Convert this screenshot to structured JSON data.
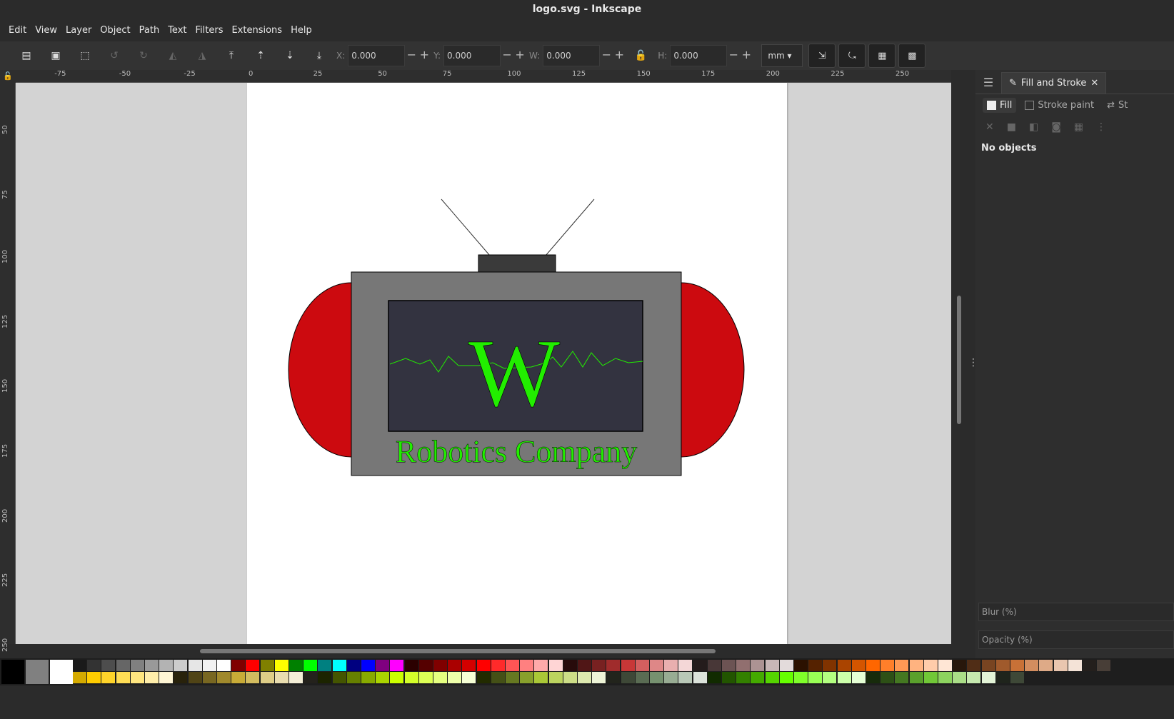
{
  "window": {
    "title": "logo.svg - Inkscape"
  },
  "menu": [
    "Edit",
    "View",
    "Layer",
    "Object",
    "Path",
    "Text",
    "Filters",
    "Extensions",
    "Help"
  ],
  "toolbar": {
    "x_label": "X:",
    "x_value": "0.000",
    "y_label": "Y:",
    "y_value": "0.000",
    "w_label": "W:",
    "w_value": "0.000",
    "h_label": "H:",
    "h_value": "0.000",
    "unit": "mm"
  },
  "rulers": {
    "h_ticks": [
      "-75",
      "-50",
      "-25",
      "0",
      "25",
      "50",
      "75",
      "100",
      "125",
      "150",
      "175",
      "200",
      "225",
      "250"
    ],
    "v_ticks": [
      "50",
      "75",
      "100",
      "125",
      "150",
      "175",
      "200",
      "225",
      "250"
    ]
  },
  "logo": {
    "letter": "W",
    "company": "Robotics Company",
    "colors": {
      "red": "#cc0a0f",
      "body": "#777777",
      "screen": "#333340",
      "green": "#22ee00",
      "antenna_box": "#3a3a3a"
    }
  },
  "dock": {
    "tab_label": "Fill and Stroke",
    "subtabs": [
      "Fill",
      "Stroke paint",
      "St"
    ],
    "status": "No objects",
    "blur_label": "Blur (%)",
    "opacity_label": "Opacity (%)"
  },
  "palette": {
    "big": [
      "#000000",
      "#808080",
      "#ffffff"
    ],
    "row1": [
      "#1a1a1a",
      "#333333",
      "#4d4d4d",
      "#666666",
      "#808080",
      "#999999",
      "#b3b3b3",
      "#cccccc",
      "#e6e6e6",
      "#f2f2f2",
      "#ffffff",
      "#800000",
      "#ff0000",
      "#808000",
      "#ffff00",
      "#008000",
      "#00ff00",
      "#008080",
      "#00ffff",
      "#000080",
      "#0000ff",
      "#800080",
      "#ff00ff",
      "#2b0000",
      "#550000",
      "#800000",
      "#aa0000",
      "#d40000",
      "#ff0000",
      "#ff2a2a",
      "#ff5555",
      "#ff8080",
      "#ffaaaa",
      "#ffd5d5",
      "#280b0b",
      "#501616",
      "#782121",
      "#a02c2c",
      "#c83737",
      "#d35f5f",
      "#de8787",
      "#e9afaf",
      "#f4d7d7",
      "#241c1c",
      "#483737",
      "#6c5353",
      "#916f6f",
      "#ac9393",
      "#c8b7b7",
      "#e3dbdb",
      "#2b1100",
      "#552200",
      "#803300",
      "#aa4400",
      "#d45500",
      "#ff6600",
      "#ff7f2a",
      "#ff9955",
      "#ffb380",
      "#ffccaa",
      "#ffe6d5",
      "#28170b",
      "#502d16",
      "#784421",
      "#a05a2c",
      "#c87137",
      "#d38d5f",
      "#deaa87",
      "#e9c6af",
      "#f4e3d7",
      "#241f1c",
      "#483e37"
    ],
    "row2": [
      "#d4aa00",
      "#ffcc00",
      "#ffd42a",
      "#ffdd55",
      "#ffe680",
      "#ffeeaa",
      "#fff6d5",
      "#28220b",
      "#504416",
      "#786721",
      "#a0892c",
      "#c8ab37",
      "#d3bc5f",
      "#decd87",
      "#e9ddaf",
      "#f4eed7",
      "#24221c",
      "#1c2400",
      "#445500",
      "#668000",
      "#88aa00",
      "#aad400",
      "#ccff00",
      "#d4ff2a",
      "#ddff55",
      "#e5ff80",
      "#eeffaa",
      "#f6ffd5",
      "#222b00",
      "#445016",
      "#667821",
      "#88a02c",
      "#aac837",
      "#bcd35f",
      "#cdde87",
      "#dde9af",
      "#eef4d7",
      "#22241c",
      "#3e4837",
      "#5a6c53",
      "#76916f",
      "#98ac93",
      "#b9c8b7",
      "#dce3db",
      "#112b00",
      "#225500",
      "#338000",
      "#44aa00",
      "#55d400",
      "#66ff00",
      "#7fff2a",
      "#99ff55",
      "#b3ff80",
      "#ccffaa",
      "#e5ffd5",
      "#172b0b",
      "#2d5016",
      "#447821",
      "#5aa02c",
      "#71c837",
      "#8dd35f",
      "#aade87",
      "#c6e9af",
      "#e3f4d7",
      "#1f241c",
      "#3e4837"
    ]
  }
}
